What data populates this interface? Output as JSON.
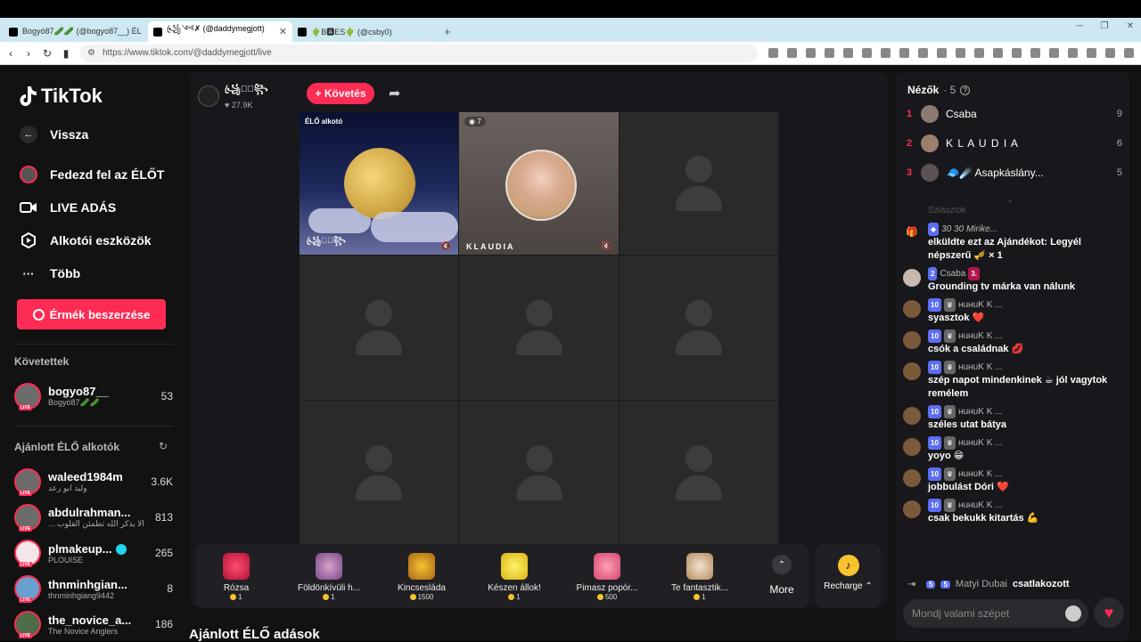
{
  "browser": {
    "tabs": [
      {
        "title": "Bogyó87🥒🥒 (@bogyo87__) ÉL",
        "active": false
      },
      {
        "title": "꧁ꦿ༺✗ (@daddymegjott)",
        "active": true
      },
      {
        "title": "🌵B🅰ES🌵 (@csby0)",
        "active": false
      }
    ],
    "url": "https://www.tiktok.com/@daddymegjott/live"
  },
  "sidebar": {
    "logo": "TikTok",
    "back_label": "Vissza",
    "nav": [
      {
        "label": "Fedezd fel az ÉLŐT",
        "icon": "avatar-icon"
      },
      {
        "label": "LIVE ADÁS",
        "icon": "camera-icon"
      },
      {
        "label": "Alkotói eszközök",
        "icon": "creator-tools-icon"
      },
      {
        "label": "Több",
        "icon": "more-icon"
      }
    ],
    "coin_button": "Érmék beszerzése",
    "following_title": "Követettek",
    "following": [
      {
        "name": "bogyo87__",
        "sub": "Bogyó87🥒🥒",
        "count": "53"
      }
    ],
    "recommended_title": "Ajánlott ÉLŐ alkotók",
    "recommended": [
      {
        "name": "waleed1984m",
        "sub": "وليد ابو رعد",
        "count": "3.6K",
        "verified": false
      },
      {
        "name": "abdulrahman...",
        "sub": "... الا بذكر الله تطمئن القلوب",
        "count": "813",
        "verified": false
      },
      {
        "name": "plmakeup...",
        "sub": "PLOUISE",
        "count": "265",
        "verified": true
      },
      {
        "name": "thnminhgian...",
        "sub": "thnminhgiang9442",
        "count": "8",
        "verified": false
      },
      {
        "name": "the_novice_a...",
        "sub": "The Novice Anglers",
        "count": "186",
        "verified": false
      }
    ]
  },
  "live": {
    "host_name": "꧁ꦿ✗ꦿ꧂",
    "host_likes": "27.9K",
    "follow_label": "+ Követés",
    "cells": {
      "creator_badge": "ÉLŐ alkotó",
      "creator_name": "꧁ꦿ✗ꦿ꧂",
      "guest_viewers": "7",
      "guest_name": "KLAUDIA"
    },
    "gifts": [
      {
        "name": "Rózsa",
        "price": "1"
      },
      {
        "name": "Földönkívüli h...",
        "price": "1"
      },
      {
        "name": "Kincsesláda",
        "price": "1500"
      },
      {
        "name": "Készen állok!",
        "price": "1"
      },
      {
        "name": "Pimasz popór...",
        "price": "500"
      },
      {
        "name": "Te fantasztik...",
        "price": "1"
      }
    ],
    "more_label": "More",
    "recharge_label": "Recharge"
  },
  "bottom_title": "Ajánlott ÉLŐ adások",
  "right": {
    "viewers_label": "Nézők",
    "viewers_count": "· 5",
    "top_viewers": [
      {
        "rank": "1",
        "name": "Csaba",
        "score": "9"
      },
      {
        "rank": "2",
        "name": "K L A U D I A",
        "score": "6"
      },
      {
        "rank": "3",
        "name": "🧢☄️ Asapkáslány...",
        "score": "5"
      }
    ],
    "faded_text": "Szlasztok",
    "chat": [
      {
        "type": "gift",
        "meta": "30 30 Mirike...",
        "text": "elküldte ezt az Ajándékot: Legyél népszerű 🎺 × 1"
      },
      {
        "type": "msg",
        "level": "2",
        "name": "Csaba",
        "rank": "3.",
        "text": "Grounding tv márka van nálunk"
      },
      {
        "type": "msg",
        "level": "10",
        "name": "ʜuʜuK K ...",
        "text": "syasztok ❤️"
      },
      {
        "type": "msg",
        "level": "10",
        "name": "ʜuʜuK K ...",
        "text": "csók a családnak 💋"
      },
      {
        "type": "msg",
        "level": "10",
        "name": "ʜuʜuK K ...",
        "text": "szép napot mindenkinek ☕ jól vagytok remélem"
      },
      {
        "type": "msg",
        "level": "10",
        "name": "ʜuʜuK K ...",
        "text": "széles utat bátya"
      },
      {
        "type": "msg",
        "level": "10",
        "name": "ʜuʜuK K ...",
        "text": "yoyo 😁"
      },
      {
        "type": "msg",
        "level": "10",
        "name": "ʜuʜuK K ...",
        "text": "jobbulást Dóri ❤️"
      },
      {
        "type": "msg",
        "level": "10",
        "name": "ʜuʜuK K ...",
        "text": "csak bekukk kitartás 💪"
      }
    ],
    "join": {
      "level": "5",
      "fan": "5",
      "name": "Matyi Dubai",
      "text": "csatlakozott"
    },
    "input_placeholder": "Mondj valami szépet"
  }
}
